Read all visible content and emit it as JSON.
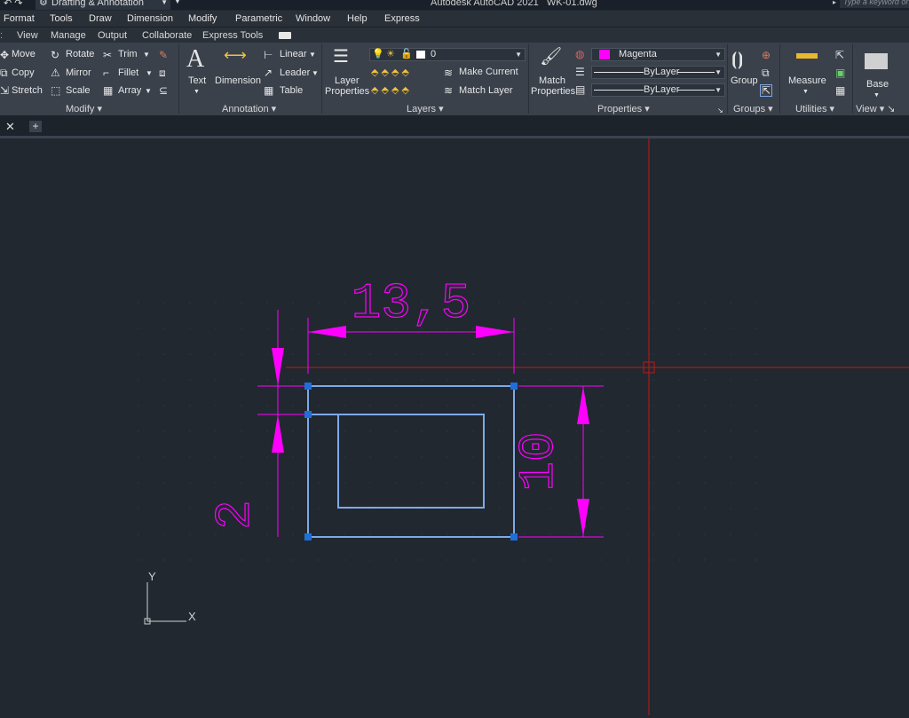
{
  "title_bar": {
    "workspace": "Drafting & Annotation",
    "app_title": "Autodesk AutoCAD 2021   WK-01.dwg",
    "search_placeholder": "Type a keyword or"
  },
  "menu": [
    "Format",
    "Tools",
    "Draw",
    "Dimension",
    "Modify",
    "Parametric",
    "Window",
    "Help",
    "Express"
  ],
  "ribbon_tabs": [
    "View",
    "Manage",
    "Output",
    "Collaborate",
    "Express Tools"
  ],
  "ribbon": {
    "modify": {
      "title": "Modify",
      "move": "Move",
      "copy": "Copy",
      "stretch": "Stretch",
      "rotate": "Rotate",
      "mirror": "Mirror",
      "scale": "Scale",
      "trim": "Trim",
      "fillet": "Fillet",
      "array": "Array"
    },
    "annotation": {
      "title": "Annotation",
      "text": "Text",
      "dimension": "Dimension",
      "linear": "Linear",
      "leader": "Leader",
      "table": "Table"
    },
    "layers": {
      "title": "Layers",
      "layer_properties_line1": "Layer",
      "layer_properties_line2": "Properties",
      "current_layer": "0",
      "make_current": "Make Current",
      "match_layer": "Match Layer"
    },
    "properties": {
      "title": "Properties",
      "match_line1": "Match",
      "match_line2": "Properties",
      "color": "Magenta",
      "color_hex": "#ff00ff",
      "linetype": "ByLayer",
      "lineweight": "ByLayer"
    },
    "groups": {
      "title": "Groups",
      "group": "Group"
    },
    "utilities": {
      "title": "Utilities",
      "measure": "Measure"
    },
    "view": {
      "title": "View",
      "base": "Base"
    }
  },
  "drawing": {
    "dim_horizontal": "13,5",
    "dim_vertical": "10",
    "dim_left": "2",
    "ucs_x": "X",
    "ucs_y": "Y",
    "dim_color": "#ff00ff",
    "selected_color": "#7fa8e8",
    "crosshair_color": "#c01818"
  }
}
